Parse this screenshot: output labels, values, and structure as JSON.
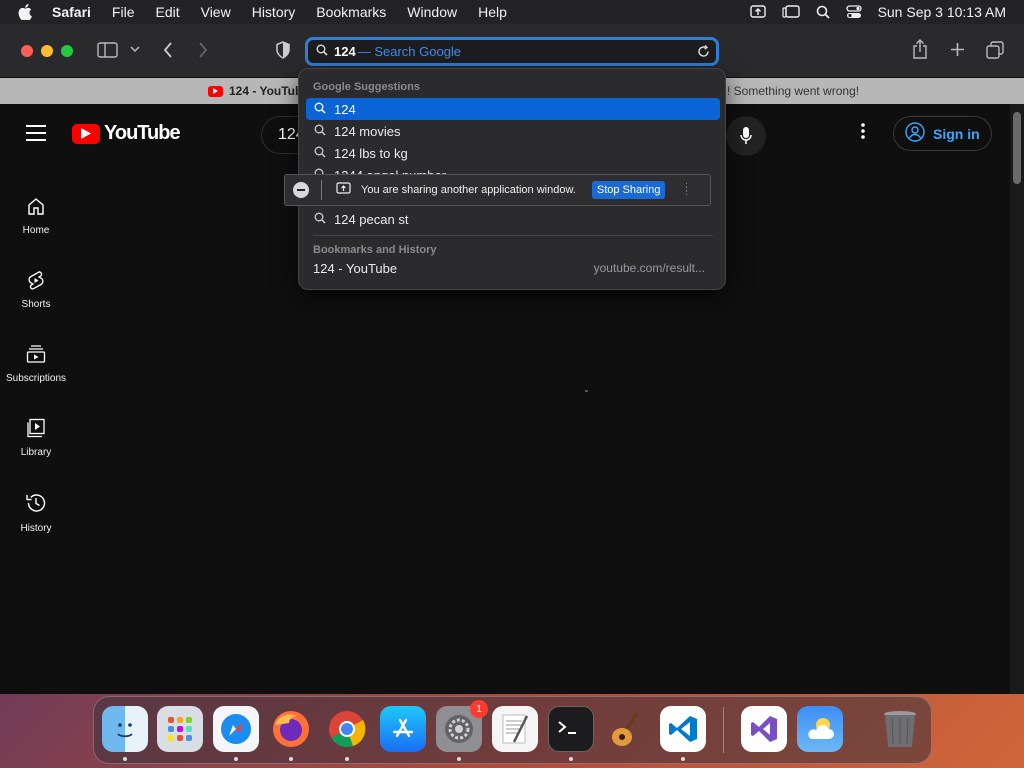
{
  "menubar": {
    "app": "Safari",
    "items": [
      "File",
      "Edit",
      "View",
      "History",
      "Bookmarks",
      "Window",
      "Help"
    ],
    "datetime": "Sun Sep 3  10:13 AM"
  },
  "urlbar": {
    "typed": "124",
    "hint": "— Search Google"
  },
  "tabs": [
    {
      "label": "124 - YouTube"
    },
    {
      "label": "! Something went wrong!"
    }
  ],
  "youtube": {
    "logo_text": "YouTube",
    "search_value": "124",
    "signin_label": "Sign in",
    "sidebar": [
      {
        "label": "Home",
        "icon": "home-icon"
      },
      {
        "label": "Shorts",
        "icon": "shorts-icon"
      },
      {
        "label": "Subscriptions",
        "icon": "subscriptions-icon"
      },
      {
        "label": "Library",
        "icon": "library-icon"
      },
      {
        "label": "History",
        "icon": "history-icon"
      }
    ]
  },
  "dropdown": {
    "google_header": "Google Suggestions",
    "suggestions": [
      "124",
      "124 movies",
      "124 lbs to kg",
      "1244 angel number",
      "124 pecan st"
    ],
    "selected_index": 0,
    "history_header": "Bookmarks and History",
    "history_item": {
      "title": "124 - YouTube",
      "url": "youtube.com/result..."
    }
  },
  "sharing_banner": {
    "text": "You are sharing another application window.",
    "stop_label": "Stop Sharing"
  },
  "dock": {
    "apps": [
      "Finder",
      "Launchpad",
      "Safari",
      "Firefox",
      "Chrome",
      "App Store",
      "System Settings",
      "TextEdit",
      "Terminal",
      "GarageBand",
      "VS Code",
      "Visual Studio",
      "Weather",
      "Trash"
    ],
    "settings_badge": "1"
  },
  "colors": {
    "accent": "#0a64d6",
    "youtube_red": "#ff0000",
    "signin_blue": "#3ea6ff"
  }
}
